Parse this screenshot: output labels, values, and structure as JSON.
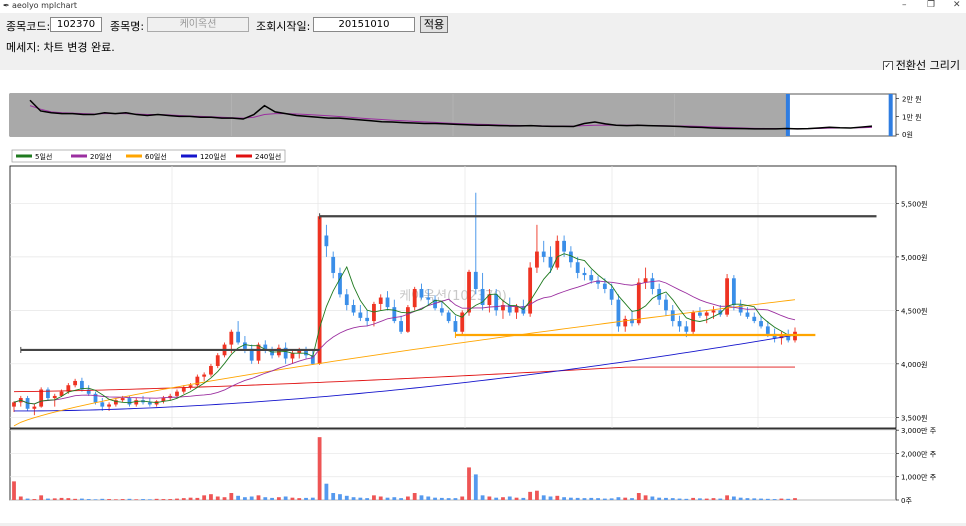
{
  "window": {
    "title": "aeolyo mplchart",
    "min": "–",
    "max": "❐",
    "close": "✕"
  },
  "form": {
    "code_label": "종목코드:",
    "code_value": "102370",
    "name_label": "종목명:",
    "name_value": "케이옥션",
    "date_label": "조회시작일:",
    "date_value": "20151010",
    "apply_label": "적용"
  },
  "message": "메세지: 차트 변경 완료.",
  "checkbox": {
    "label": "전환선 그리기",
    "checked": true,
    "mark": "✓"
  },
  "colors": {
    "up": "#ee3322",
    "down": "#3a8ee8",
    "ma5": "#1f7a1f",
    "ma20": "#9b2fa0",
    "ma60": "#ffa500",
    "ma120": "#1414cc",
    "ma240": "#e01010",
    "volume_up": "#ee5555",
    "volume_down": "#5599ee"
  },
  "chart_data": {
    "type": "candlestick",
    "watermark": "케이옥션(102370)",
    "legend": [
      {
        "label": "5일선",
        "color": "#1f7a1f"
      },
      {
        "label": "20일선",
        "color": "#9b2fa0"
      },
      {
        "label": "60일선",
        "color": "#ffa500"
      },
      {
        "label": "120일선",
        "color": "#1414cc"
      },
      {
        "label": "240일선",
        "color": "#e01010"
      }
    ],
    "price_ticks": [
      "5,500원",
      "5,000원",
      "4,500원",
      "4,000원",
      "3,500원"
    ],
    "price_tick_values": [
      5500,
      5000,
      4500,
      4000,
      3500
    ],
    "price_ylim": [
      3400,
      5850
    ],
    "volume_ticks": [
      "3,000만 주",
      "2,000만 주",
      "1,000만 주",
      "0주"
    ],
    "volume_tick_values": [
      3000,
      2000,
      1000,
      0
    ],
    "volume_ylim": [
      0,
      3050
    ],
    "overview_ticks": [
      "2만 원",
      "1만 원",
      "0원"
    ],
    "overview_tick_values": [
      20000,
      10000,
      0
    ],
    "overview_ylim": [
      -1000,
      22500
    ],
    "overview_close": [
      19000,
      13000,
      12000,
      11500,
      11500,
      11000,
      11000,
      12000,
      11500,
      12000,
      11000,
      10500,
      11000,
      10500,
      10000,
      10000,
      9500,
      9500,
      9000,
      9000,
      8500,
      11000,
      16000,
      12500,
      11500,
      10500,
      10000,
      9500,
      9000,
      9000,
      8500,
      8000,
      7500,
      7000,
      6800,
      6500,
      6300,
      6000,
      6000,
      5800,
      5500,
      5300,
      5000,
      5000,
      4800,
      4700,
      4700,
      4800,
      4500,
      4400,
      4400,
      4300,
      6000,
      6800,
      5800,
      5000,
      4800,
      5000,
      4800,
      4700,
      4500,
      4300,
      4000,
      3800,
      3500,
      3300,
      3200,
      3100,
      3000,
      3000,
      3000,
      3200,
      3000,
      3100,
      3500,
      3900,
      3600,
      3500,
      4000,
      4500
    ],
    "overview_ma": [
      16000,
      14000,
      12500,
      12000,
      11800,
      11500,
      11300,
      11500,
      11500,
      11500,
      11300,
      11000,
      11000,
      10800,
      10500,
      10200,
      10000,
      9800,
      9500,
      9200,
      9000,
      9500,
      11000,
      11500,
      11500,
      11300,
      11000,
      10700,
      10300,
      9900,
      9500,
      9000,
      8600,
      8200,
      7800,
      7500,
      7200,
      6900,
      6600,
      6300,
      6000,
      5800,
      5600,
      5400,
      5200,
      5000,
      4900,
      4800,
      4700,
      4600,
      4500,
      4500,
      4800,
      5000,
      5100,
      5100,
      5000,
      5000,
      4900,
      4800,
      4700,
      4600,
      4500,
      4300,
      4100,
      3900,
      3700,
      3500,
      3300,
      3200,
      3100,
      3100,
      3100,
      3100,
      3200,
      3400,
      3500,
      3500,
      3600,
      3800
    ],
    "overview_selection": [
      0.878,
      0.994
    ],
    "candles": [
      [
        3600,
        3650,
        3550,
        3640
      ],
      [
        3640,
        3700,
        3600,
        3680
      ],
      [
        3680,
        3700,
        3560,
        3580
      ],
      [
        3580,
        3620,
        3520,
        3600
      ],
      [
        3600,
        3780,
        3590,
        3760
      ],
      [
        3760,
        3780,
        3660,
        3680
      ],
      [
        3680,
        3720,
        3600,
        3700
      ],
      [
        3700,
        3760,
        3690,
        3740
      ],
      [
        3740,
        3820,
        3720,
        3800
      ],
      [
        3800,
        3860,
        3780,
        3840
      ],
      [
        3840,
        3870,
        3740,
        3760
      ],
      [
        3760,
        3800,
        3700,
        3720
      ],
      [
        3720,
        3740,
        3620,
        3640
      ],
      [
        3640,
        3680,
        3560,
        3600
      ],
      [
        3600,
        3640,
        3560,
        3620
      ],
      [
        3620,
        3680,
        3600,
        3660
      ],
      [
        3660,
        3700,
        3640,
        3680
      ],
      [
        3680,
        3700,
        3600,
        3620
      ],
      [
        3620,
        3680,
        3600,
        3660
      ],
      [
        3660,
        3700,
        3620,
        3640
      ],
      [
        3640,
        3680,
        3600,
        3620
      ],
      [
        3620,
        3660,
        3600,
        3650
      ],
      [
        3650,
        3700,
        3630,
        3680
      ],
      [
        3680,
        3720,
        3660,
        3700
      ],
      [
        3700,
        3760,
        3680,
        3740
      ],
      [
        3740,
        3800,
        3720,
        3780
      ],
      [
        3780,
        3820,
        3760,
        3800
      ],
      [
        3800,
        3900,
        3780,
        3880
      ],
      [
        3880,
        3920,
        3840,
        3900
      ],
      [
        3900,
        4000,
        3880,
        3980
      ],
      [
        3980,
        4100,
        3960,
        4080
      ],
      [
        4080,
        4200,
        4060,
        4180
      ],
      [
        4180,
        4320,
        4100,
        4300
      ],
      [
        4300,
        4400,
        4180,
        4200
      ],
      [
        4200,
        4260,
        4100,
        4140
      ],
      [
        4140,
        4180,
        4000,
        4030
      ],
      [
        4030,
        4200,
        4000,
        4180
      ],
      [
        4180,
        4220,
        4100,
        4120
      ],
      [
        4120,
        4160,
        4050,
        4080
      ],
      [
        4080,
        4180,
        4060,
        4150
      ],
      [
        4150,
        4200,
        4000,
        4050
      ],
      [
        4050,
        4120,
        4000,
        4100
      ],
      [
        4100,
        4150,
        4050,
        4120
      ],
      [
        4120,
        4160,
        4050,
        4080
      ],
      [
        4080,
        4120,
        3990,
        4000
      ],
      [
        4000,
        5380,
        3990,
        5380
      ],
      [
        5200,
        5300,
        5000,
        5100
      ],
      [
        5000,
        5050,
        4800,
        4850
      ],
      [
        4850,
        4900,
        4620,
        4650
      ],
      [
        4650,
        4700,
        4500,
        4550
      ],
      [
        4550,
        4600,
        4450,
        4480
      ],
      [
        4480,
        4550,
        4400,
        4430
      ],
      [
        4430,
        4500,
        4350,
        4400
      ],
      [
        4400,
        4580,
        4350,
        4560
      ],
      [
        4560,
        4650,
        4500,
        4620
      ],
      [
        4620,
        4680,
        4500,
        4530
      ],
      [
        4530,
        4600,
        4380,
        4400
      ],
      [
        4400,
        4450,
        4280,
        4300
      ],
      [
        4300,
        4550,
        4290,
        4530
      ],
      [
        4530,
        4720,
        4500,
        4700
      ],
      [
        4700,
        4750,
        4600,
        4620
      ],
      [
        4620,
        4700,
        4550,
        4600
      ],
      [
        4600,
        4640,
        4500,
        4520
      ],
      [
        4520,
        4580,
        4450,
        4480
      ],
      [
        4480,
        4500,
        4380,
        4400
      ],
      [
        4400,
        4450,
        4270,
        4300
      ],
      [
        4300,
        4500,
        4270,
        4480
      ],
      [
        4480,
        4880,
        4450,
        4860
      ],
      [
        4860,
        5600,
        4650,
        4700
      ],
      [
        4700,
        4850,
        4500,
        4550
      ],
      [
        4550,
        4700,
        4480,
        4650
      ],
      [
        4650,
        4700,
        4450,
        4500
      ],
      [
        4500,
        4600,
        4420,
        4550
      ],
      [
        4550,
        4620,
        4450,
        4480
      ],
      [
        4480,
        4560,
        4420,
        4540
      ],
      [
        4540,
        4600,
        4450,
        4470
      ],
      [
        4470,
        4950,
        4440,
        4900
      ],
      [
        4900,
        5300,
        4850,
        5050
      ],
      [
        5050,
        5150,
        4950,
        5000
      ],
      [
        5000,
        5100,
        4850,
        4900
      ],
      [
        4900,
        5200,
        4880,
        5150
      ],
      [
        5150,
        5200,
        5000,
        5050
      ],
      [
        5050,
        5100,
        4900,
        4950
      ],
      [
        4950,
        5000,
        4800,
        4850
      ],
      [
        4850,
        4900,
        4780,
        4830
      ],
      [
        4830,
        4880,
        4750,
        4780
      ],
      [
        4780,
        4820,
        4700,
        4750
      ],
      [
        4750,
        4800,
        4660,
        4700
      ],
      [
        4700,
        4750,
        4550,
        4600
      ],
      [
        4600,
        4650,
        4300,
        4350
      ],
      [
        4350,
        4450,
        4300,
        4420
      ],
      [
        4420,
        4500,
        4350,
        4380
      ],
      [
        4380,
        4800,
        4360,
        4760
      ],
      [
        4760,
        4900,
        4700,
        4800
      ],
      [
        4800,
        4850,
        4650,
        4700
      ],
      [
        4700,
        4750,
        4550,
        4600
      ],
      [
        4600,
        4650,
        4450,
        4500
      ],
      [
        4500,
        4550,
        4350,
        4400
      ],
      [
        4400,
        4450,
        4300,
        4350
      ],
      [
        4350,
        4400,
        4250,
        4300
      ],
      [
        4300,
        4500,
        4280,
        4480
      ],
      [
        4480,
        4530,
        4430,
        4450
      ],
      [
        4450,
        4500,
        4380,
        4480
      ],
      [
        4480,
        4540,
        4420,
        4500
      ],
      [
        4500,
        4550,
        4440,
        4460
      ],
      [
        4460,
        4840,
        4440,
        4800
      ],
      [
        4800,
        4830,
        4500,
        4550
      ],
      [
        4550,
        4600,
        4450,
        4480
      ],
      [
        4480,
        4530,
        4420,
        4440
      ],
      [
        4440,
        4480,
        4380,
        4400
      ],
      [
        4400,
        4450,
        4330,
        4350
      ],
      [
        4350,
        4400,
        4250,
        4280
      ],
      [
        4280,
        4330,
        4200,
        4240
      ],
      [
        4240,
        4300,
        4180,
        4260
      ],
      [
        4260,
        4320,
        4200,
        4220
      ],
      [
        4220,
        4340,
        4200,
        4300
      ]
    ],
    "volumes": [
      800,
      150,
      60,
      40,
      200,
      60,
      70,
      90,
      80,
      50,
      60,
      40,
      30,
      50,
      40,
      30,
      40,
      50,
      30,
      40,
      30,
      50,
      40,
      40,
      60,
      80,
      100,
      90,
      200,
      250,
      150,
      120,
      300,
      180,
      120,
      150,
      200,
      120,
      90,
      120,
      150,
      100,
      80,
      90,
      100,
      2700,
      700,
      300,
      250,
      180,
      120,
      100,
      80,
      200,
      150,
      100,
      120,
      80,
      150,
      300,
      200,
      150,
      100,
      90,
      80,
      80,
      150,
      1400,
      1100,
      200,
      150,
      100,
      120,
      150,
      100,
      90,
      350,
      400,
      200,
      150,
      180,
      120,
      100,
      90,
      80,
      90,
      80,
      60,
      70,
      120,
      100,
      80,
      300,
      200,
      150,
      100,
      90,
      80,
      60,
      50,
      90,
      70,
      60,
      80,
      60,
      200,
      150,
      100,
      80,
      70,
      60,
      50,
      40,
      60,
      50,
      80
    ],
    "transition_lines": [
      {
        "price": 4130,
        "from": 1,
        "to": 45
      },
      {
        "price": 5380,
        "from": 45,
        "to": 127
      },
      {
        "price": 4270,
        "from": 65,
        "to": 118
      }
    ]
  }
}
